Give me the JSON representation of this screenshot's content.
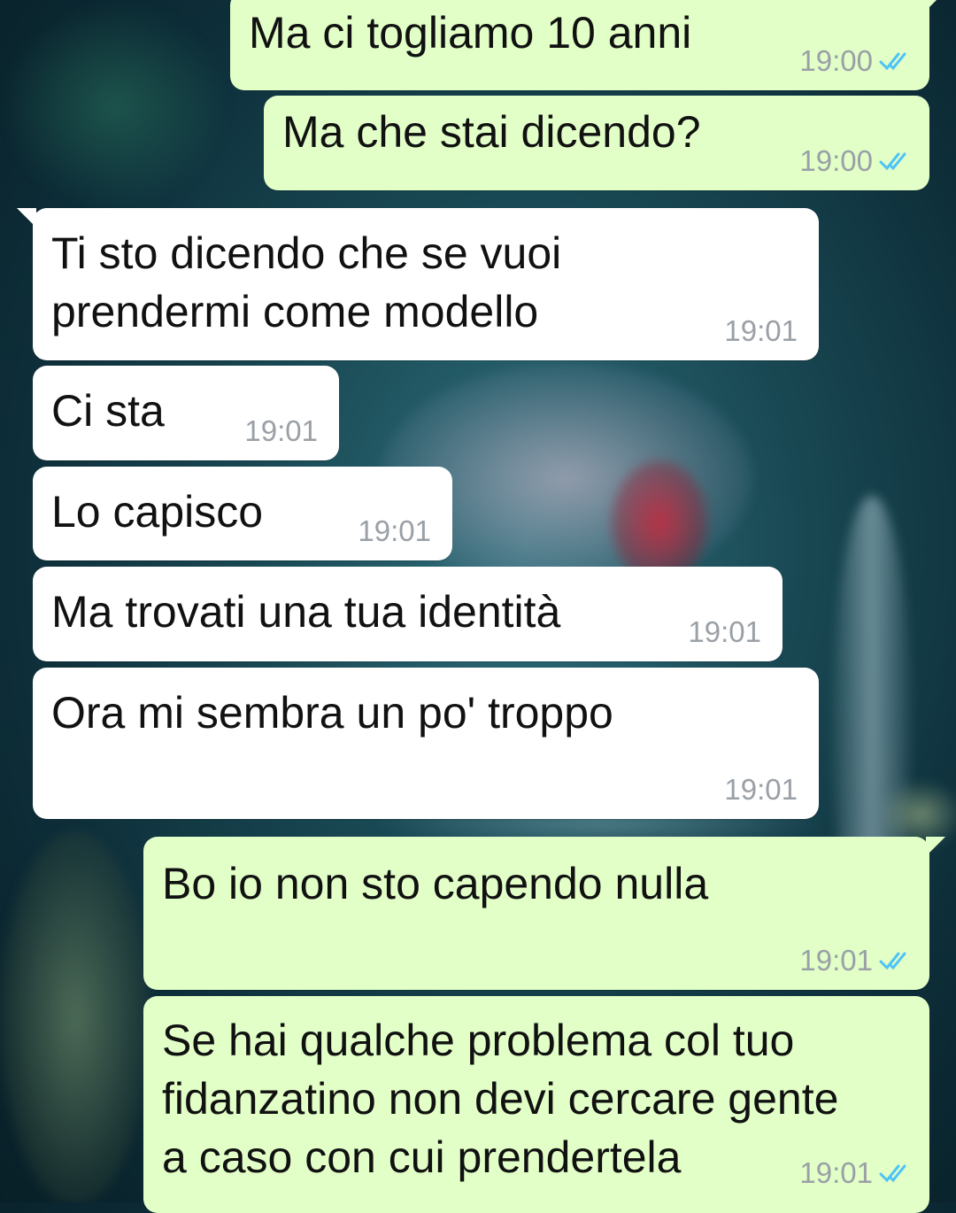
{
  "colors": {
    "outgoing_bubble": "#e1ffc7",
    "incoming_bubble": "#ffffff",
    "timestamp": "#9aa0a6",
    "read_ticks": "#4fc3f7"
  },
  "messages": [
    {
      "direction": "outgoing",
      "text": "Ma ci togliamo 10 anni",
      "time": "19:00",
      "status_icon": "double-check-read-icon"
    },
    {
      "direction": "outgoing",
      "text": "Ma che stai dicendo?",
      "time": "19:00",
      "status_icon": "double-check-read-icon"
    },
    {
      "direction": "incoming",
      "text": "Ti sto dicendo che se vuoi\nprendermi come modello",
      "time": "19:01"
    },
    {
      "direction": "incoming",
      "text": "Ci sta",
      "time": "19:01"
    },
    {
      "direction": "incoming",
      "text": "Lo capisco",
      "time": "19:01"
    },
    {
      "direction": "incoming",
      "text": "Ma trovati una tua identità",
      "time": "19:01"
    },
    {
      "direction": "incoming",
      "text": "Ora mi sembra un po' troppo",
      "time": "19:01"
    },
    {
      "direction": "outgoing",
      "text": "Bo io non sto capendo nulla",
      "time": "19:01",
      "status_icon": "double-check-read-icon"
    },
    {
      "direction": "outgoing",
      "text": "Se hai qualche problema col tuo\nfidanzatino non devi cercare gente\na caso con cui prendertela",
      "time": "19:01",
      "status_icon": "double-check-read-icon"
    }
  ]
}
